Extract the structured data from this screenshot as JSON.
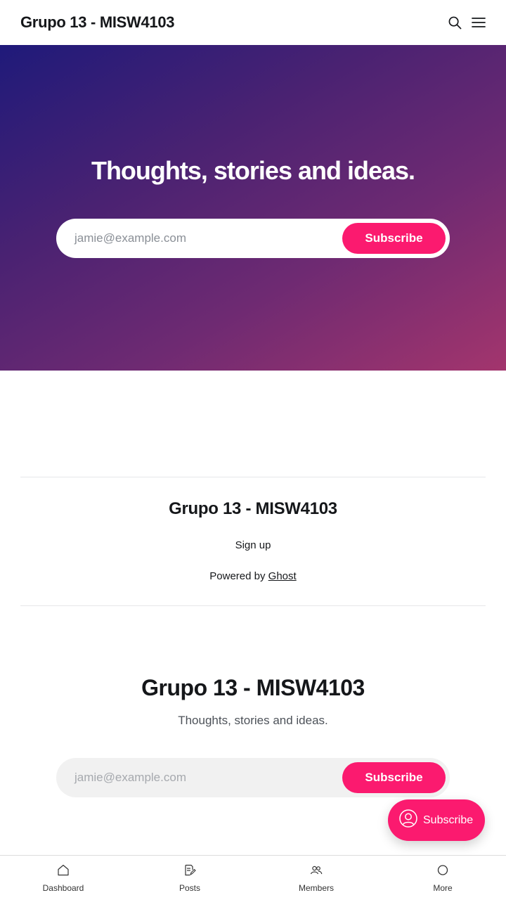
{
  "header": {
    "site_title": "Grupo 13 - MISW4103"
  },
  "hero": {
    "title": "Thoughts, stories and ideas.",
    "email_placeholder": "jamie@example.com",
    "subscribe_label": "Subscribe"
  },
  "footer": {
    "site_title": "Grupo 13 - MISW4103",
    "signup_label": "Sign up",
    "powered_prefix": "Powered by ",
    "ghost_label": "Ghost"
  },
  "cta": {
    "title": "Grupo 13 - MISW4103",
    "description": "Thoughts, stories and ideas.",
    "email_placeholder": "jamie@example.com",
    "subscribe_label": "Subscribe"
  },
  "portal": {
    "label": "Subscribe"
  },
  "bottom_nav": {
    "items": [
      {
        "label": "Dashboard",
        "icon": "home-icon"
      },
      {
        "label": "Posts",
        "icon": "posts-icon"
      },
      {
        "label": "Members",
        "icon": "members-icon"
      },
      {
        "label": "More",
        "icon": "more-icon"
      }
    ]
  },
  "colors": {
    "accent": "#fb1a6f",
    "text": "#15171a",
    "hero_start": "#1f1a7a",
    "hero_end": "#a3356d"
  }
}
